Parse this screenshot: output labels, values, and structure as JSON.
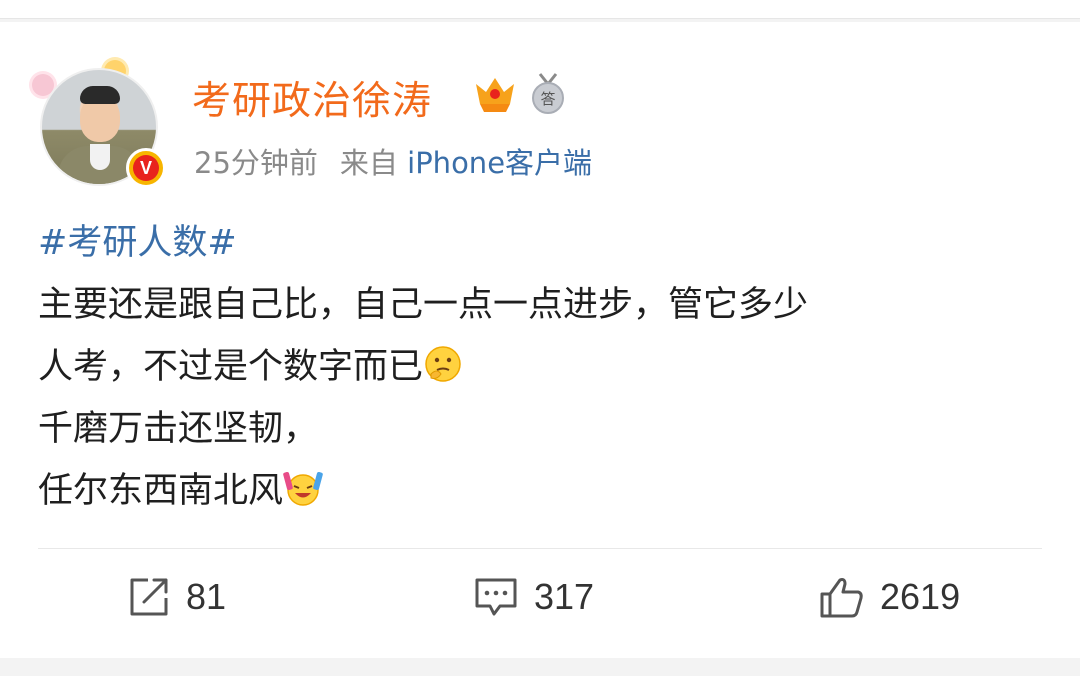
{
  "post": {
    "author": "考研政治徐涛",
    "time": "25分钟前",
    "source_prefix": "来自",
    "source": "iPhone客户端",
    "topic": "#考研人数#",
    "lines": [
      "主要还是跟自己比，自己一点一点进步，管它多少",
      "人考，不过是个数字而已",
      "千磨万击还坚韧，",
      "任尔东西南北风"
    ]
  },
  "actions": {
    "repost_count": "81",
    "comment_count": "317",
    "like_count": "2619"
  },
  "icons": {
    "verified": "verified-v-icon",
    "vip": "vip-crown-icon",
    "answer": "answer-medal-icon",
    "thinking": "thinking-emoji-icon",
    "cheer": "cheering-emoji-icon",
    "repost": "repost-icon",
    "comment": "comment-icon",
    "like": "thumbs-up-icon"
  },
  "colors": {
    "author": "#f26a1b",
    "link": "#3a6ea8",
    "meta": "#8a8a8a",
    "text": "#1f1f1f"
  }
}
